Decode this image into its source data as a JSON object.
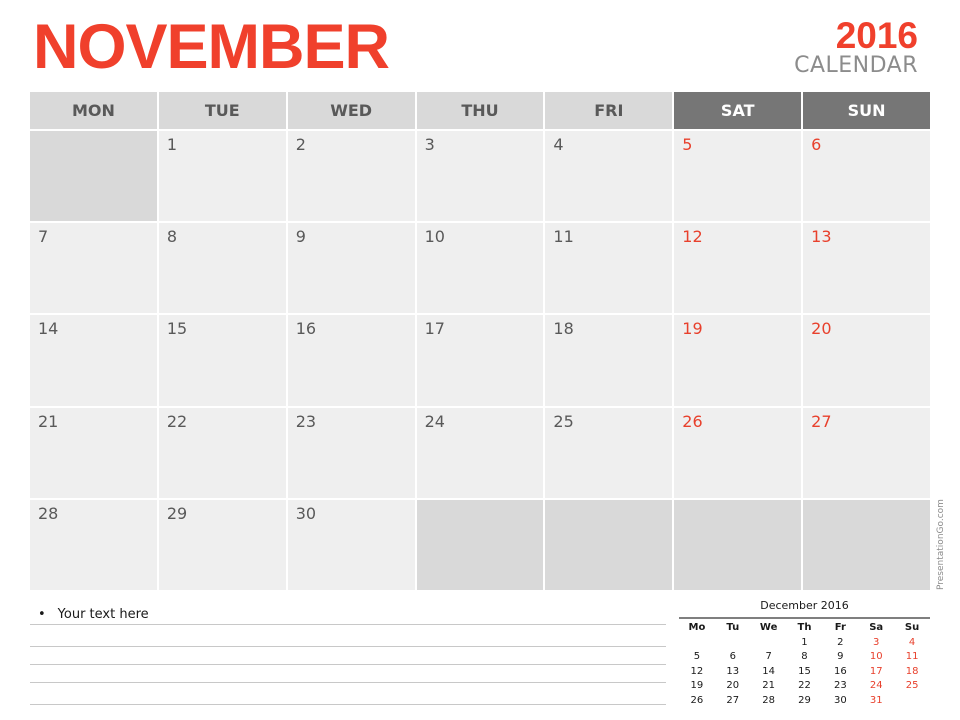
{
  "header": {
    "month": "NOVEMBER",
    "year": "2016",
    "subtitle": "CALENDAR"
  },
  "colors": {
    "accent": "#f0402c",
    "weekend_header": "#767676",
    "header_bg": "#d9d9d9",
    "cell_bg": "#efefef",
    "blank_cell_bg": "#d9d9d9",
    "text": "#595959"
  },
  "calendar": {
    "day_headers": [
      "MON",
      "TUE",
      "WED",
      "THU",
      "FRI",
      "SAT",
      "SUN"
    ],
    "weeks": [
      [
        "",
        "1",
        "2",
        "3",
        "4",
        "5",
        "6"
      ],
      [
        "7",
        "8",
        "9",
        "10",
        "11",
        "12",
        "13"
      ],
      [
        "14",
        "15",
        "16",
        "17",
        "18",
        "19",
        "20"
      ],
      [
        "21",
        "22",
        "23",
        "24",
        "25",
        "26",
        "27"
      ],
      [
        "28",
        "29",
        "30",
        "",
        "",
        "",
        ""
      ]
    ]
  },
  "notes": {
    "bullet": "•",
    "text": "Your text here"
  },
  "mini_calendar": {
    "title": "December 2016",
    "day_headers": [
      "Mo",
      "Tu",
      "We",
      "Th",
      "Fr",
      "Sa",
      "Su"
    ],
    "weeks": [
      [
        "",
        "",
        "",
        "1",
        "2",
        "3",
        "4"
      ],
      [
        "5",
        "6",
        "7",
        "8",
        "9",
        "10",
        "11"
      ],
      [
        "12",
        "13",
        "14",
        "15",
        "16",
        "17",
        "18"
      ],
      [
        "19",
        "20",
        "21",
        "22",
        "23",
        "24",
        "25"
      ],
      [
        "26",
        "27",
        "28",
        "29",
        "30",
        "31",
        ""
      ]
    ]
  },
  "watermark": "PresentationGo.com"
}
